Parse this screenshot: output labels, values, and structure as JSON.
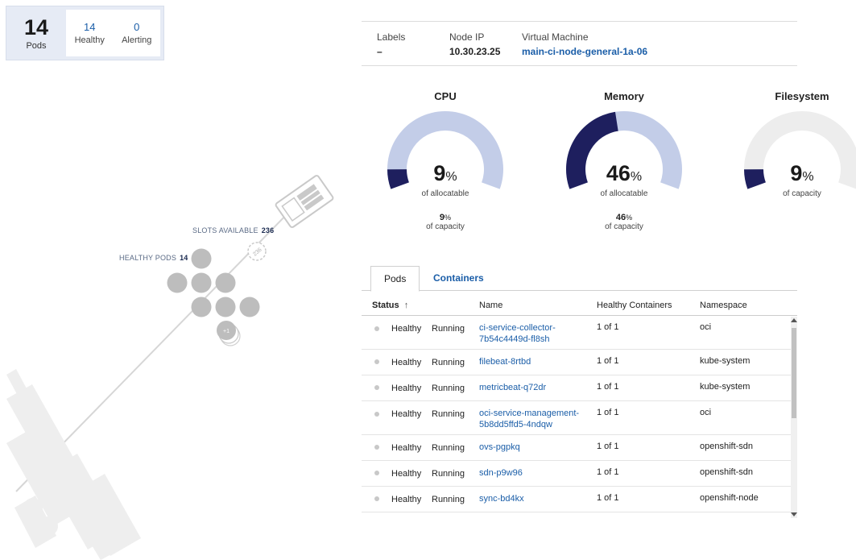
{
  "summary": {
    "pods_total": "14",
    "pods_label": "Pods",
    "healthy_value": "14",
    "healthy_label": "Healthy",
    "alerting_value": "0",
    "alerting_label": "Alerting"
  },
  "illustration": {
    "slots_label": "SLOTS AVAILABLE",
    "slots_value": "236",
    "slots_badge": "236",
    "healthy_pods_label": "HEALTHY PODS",
    "healthy_pods_value": "14",
    "more_badge": "+1"
  },
  "info": {
    "labels_key": "Labels",
    "labels_value": "–",
    "node_ip_key": "Node IP",
    "node_ip_value": "10.30.23.25",
    "vm_key": "Virtual Machine",
    "vm_value": "main-ci-node-general-1a-06"
  },
  "gauges": {
    "cpu": {
      "title": "CPU",
      "value": "9",
      "fraction": 0.09,
      "sub": "of allocatable",
      "cap_value": "9",
      "cap_sub": "of capacity"
    },
    "memory": {
      "title": "Memory",
      "value": "46",
      "fraction": 0.46,
      "sub": "of allocatable",
      "cap_value": "46",
      "cap_sub": "of capacity"
    },
    "filesystem": {
      "title": "Filesystem",
      "value": "9",
      "fraction": 0.09,
      "sub": "of capacity"
    },
    "pct_sign": "%"
  },
  "colors": {
    "gauge_fill": "#1e1f5e",
    "gauge_track": "#c3cde8",
    "gauge_track_fs": "#ededed",
    "link": "#1b5ea8"
  },
  "tabs": {
    "pods": "Pods",
    "containers": "Containers"
  },
  "table": {
    "headers": {
      "status": "Status",
      "name": "Name",
      "healthy_containers": "Healthy Containers",
      "namespace": "Namespace"
    },
    "rows": [
      {
        "health": "Healthy",
        "phase": "Running",
        "name_line1": "ci-service-collector-",
        "name_line2": "7b54c4449d-fl8sh",
        "containers": "1 of 1",
        "namespace": "oci"
      },
      {
        "health": "Healthy",
        "phase": "Running",
        "name_line1": "filebeat-8rtbd",
        "name_line2": "",
        "containers": "1 of 1",
        "namespace": "kube-system"
      },
      {
        "health": "Healthy",
        "phase": "Running",
        "name_line1": "metricbeat-q72dr",
        "name_line2": "",
        "containers": "1 of 1",
        "namespace": "kube-system"
      },
      {
        "health": "Healthy",
        "phase": "Running",
        "name_line1": "oci-service-management-",
        "name_line2": "5b8dd5ffd5-4ndqw",
        "containers": "1 of 1",
        "namespace": "oci"
      },
      {
        "health": "Healthy",
        "phase": "Running",
        "name_line1": "ovs-pgpkq",
        "name_line2": "",
        "containers": "1 of 1",
        "namespace": "openshift-sdn"
      },
      {
        "health": "Healthy",
        "phase": "Running",
        "name_line1": "sdn-p9w96",
        "name_line2": "",
        "containers": "1 of 1",
        "namespace": "openshift-sdn"
      },
      {
        "health": "Healthy",
        "phase": "Running",
        "name_line1": "sync-bd4kx",
        "name_line2": "",
        "containers": "1 of 1",
        "namespace": "openshift-node"
      }
    ]
  }
}
